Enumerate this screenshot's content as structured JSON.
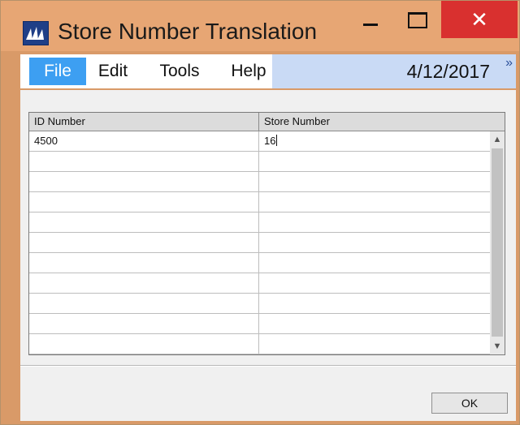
{
  "window": {
    "title": "Store Number Translation",
    "icon": "app-logo-icon",
    "controls": {
      "minimize_icon": "minimize-icon",
      "maximize_icon": "maximize-icon",
      "close_glyph": "✕"
    }
  },
  "menu": {
    "items": [
      "File",
      "Edit",
      "Tools",
      "Help"
    ],
    "date": "4/12/2017",
    "expand_glyph": "»"
  },
  "grid": {
    "columns": [
      "ID Number",
      "Store Number"
    ],
    "rows": [
      [
        "4500",
        "16"
      ],
      [
        "",
        ""
      ],
      [
        "",
        ""
      ],
      [
        "",
        ""
      ],
      [
        "",
        ""
      ],
      [
        "",
        ""
      ],
      [
        "",
        ""
      ],
      [
        "",
        ""
      ],
      [
        "",
        ""
      ],
      [
        "",
        ""
      ],
      [
        "",
        ""
      ]
    ]
  },
  "buttons": {
    "ok": "OK"
  },
  "colors": {
    "titlebar": "#e7a674",
    "close": "#d9302f",
    "menu_selected": "#3d9ff2",
    "date_panel": "#c9daf5"
  }
}
